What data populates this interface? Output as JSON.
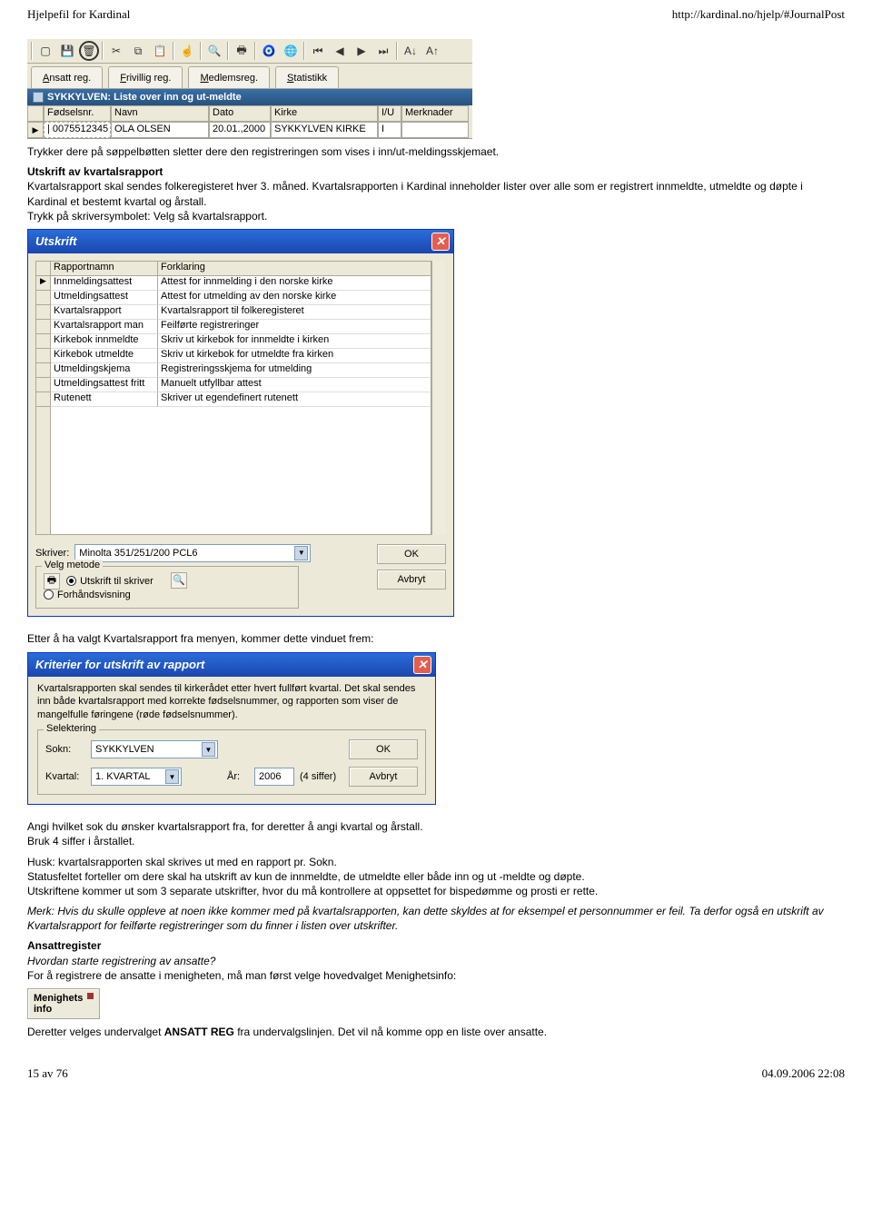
{
  "header": {
    "left": "Hjelpefil for Kardinal",
    "right": "http://kardinal.no/hjelp/#JournalPost"
  },
  "app": {
    "tabs": [
      {
        "label": "Ansatt reg.",
        "ul": "A"
      },
      {
        "label": "Frivillig reg.",
        "ul": "F"
      },
      {
        "label": "Medlemsreg.",
        "ul": "M"
      },
      {
        "label": "Statistikk",
        "ul": "S"
      }
    ],
    "titlebar": "SYKKYLVEN: Liste over inn og ut-meldte",
    "columns": {
      "fod": "Fødselsnr.",
      "navn": "Navn",
      "dato": "Dato",
      "kirke": "Kirke",
      "iu": "I/U",
      "merk": "Merknader"
    },
    "row": {
      "fod": "| 0075512345",
      "navn": "OLA OLSEN",
      "dato": "20.01.,2000",
      "kirke": "SYKKYLVEN KIRKE",
      "iu": "I",
      "merk": ""
    }
  },
  "text1": "Trykker dere på søppelbøtten sletter dere den registreringen som vises i inn/ut-meldingsskjemaet.",
  "text2_title": "Utskrift av kvartalsrapport",
  "text2_body": "Kvartalsrapport skal sendes folkeregisteret hver 3. måned. Kvartalsrapporten i Kardinal inneholder lister over alle som er registrert innmeldte, utmeldte og døpte i Kardinal et bestemt kvartal og årstall.\nTrykk på skriversymbolet: Velg så kvartalsrapport.",
  "utskrift": {
    "title": "Utskrift",
    "cols": {
      "name": "Rapportnamn",
      "expl": "Forklaring"
    },
    "rows": [
      {
        "name": "Innmeldingsattest",
        "expl": "Attest for innmelding i den norske kirke"
      },
      {
        "name": "Utmeldingsattest",
        "expl": "Attest for utmelding av den norske kirke"
      },
      {
        "name": "Kvartalsrapport",
        "expl": "Kvartalsrapport til folkeregisteret"
      },
      {
        "name": "Kvartalsrapport man",
        "expl": "Feilførte registreringer"
      },
      {
        "name": "Kirkebok innmeldte",
        "expl": "Skriv ut kirkebok for innmeldte i kirken"
      },
      {
        "name": "Kirkebok utmeldte",
        "expl": "Skriv ut kirkebok for utmeldte fra kirken"
      },
      {
        "name": "Utmeldingskjema",
        "expl": "Registreringsskjema for utmelding"
      },
      {
        "name": "Utmeldingsattest fritt",
        "expl": "Manuelt utfyllbar attest"
      },
      {
        "name": "Rutenett",
        "expl": "Skriver ut egendefinert rutenett"
      }
    ],
    "skriver_label": "Skriver:",
    "skriver_value": "Minolta 351/251/200 PCL6",
    "group": "Velg metode",
    "radio1": "Utskrift til skriver",
    "radio2": "Forhåndsvisning",
    "ok": "OK",
    "cancel": "Avbryt"
  },
  "text3": "Etter å ha valgt Kvartalsrapport fra menyen, kommer dette vinduet frem:",
  "kriterier": {
    "title": "Kriterier for utskrift av rapport",
    "intro": "Kvartalsrapporten skal sendes til kirkerådet etter hvert fullført kvartal. Det skal sendes inn både kvartalsrapport med korrekte fødselsnummer, og rapporten som viser de mangelfulle føringene (røde fødselsnummer).",
    "group": "Selektering",
    "sokn_label": "Sokn:",
    "sokn_value": "SYKKYLVEN",
    "kvartal_label": "Kvartal:",
    "kvartal_value": "1. KVARTAL",
    "aar_label": "År:",
    "aar_value": "2006",
    "aar_hint": "(4 siffer)",
    "ok": "OK",
    "cancel": "Avbryt"
  },
  "text4": "Angi hvilket sok du ønsker kvartalsrapport fra, for deretter å angi kvartal og årstall.\nBruk 4 siffer i årstallet.",
  "text5": "Husk: kvartalsrapporten skal skrives ut med en rapport pr. Sokn.\nStatusfeltet forteller om dere skal ha utskrift av kun de innmeldte, de utmeldte eller både inn og ut -meldte og døpte.\nUtskriftene kommer ut som 3 separate utskrifter, hvor du må kontrollere at oppsettet for bispedømme og prosti er rette.",
  "text6": "Merk: Hvis du skulle oppleve at noen ikke kommer med på kvartalsrapporten, kan dette skyldes at for eksempel et personnummer er feil. Ta derfor også en utskrift av Kvartalsrapport for feilførte registreringer som du finner i listen over utskrifter.",
  "text7_title": "Ansattregister",
  "text7_italic": "Hvordan starte registrering av ansatte?",
  "text7_body": "For å registrere de ansatte i menigheten, må man først velge hovedvalget Menighetsinfo:",
  "menighets": {
    "line1": "Menighets",
    "line2": "info"
  },
  "text8_pre": "Deretter velges undervalget ",
  "text8_bold": "ANSATT REG",
  "text8_post": " fra undervalgslinjen. Det vil nå komme opp en liste over ansatte.",
  "footer": {
    "left": "15 av 76",
    "right": "04.09.2006 22:08"
  }
}
